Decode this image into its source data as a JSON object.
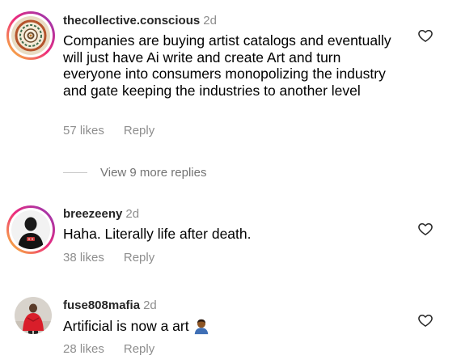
{
  "comments": [
    {
      "username": "thecollective.conscious",
      "time": "2d",
      "text": "Companies are buying artist catalogs and eventually will just have Ai write and create Art and turn everyone into consumers monopolizing the industry and gate keeping the industries to another level",
      "likes": "57 likes",
      "reply": "Reply",
      "icon": "heart-outline-icon"
    },
    {
      "username": "breezeeny",
      "time": "2d",
      "text": "Haha.  Literally life after death.",
      "likes": "38 likes",
      "reply": "Reply",
      "icon": "heart-outline-icon"
    },
    {
      "username": "fuse808mafia",
      "time": "2d",
      "text": "Artificial is now a art",
      "likes": "28 likes",
      "reply": "Reply",
      "icon": "heart-outline-icon"
    }
  ],
  "view_more": {
    "label": "View 9 more replies"
  },
  "colors": {
    "secondary_text": "#8e8e8e",
    "story_ring_start": "#f9ce34",
    "story_ring_mid": "#ee2a7b",
    "story_ring_end": "#8a3ab9"
  }
}
